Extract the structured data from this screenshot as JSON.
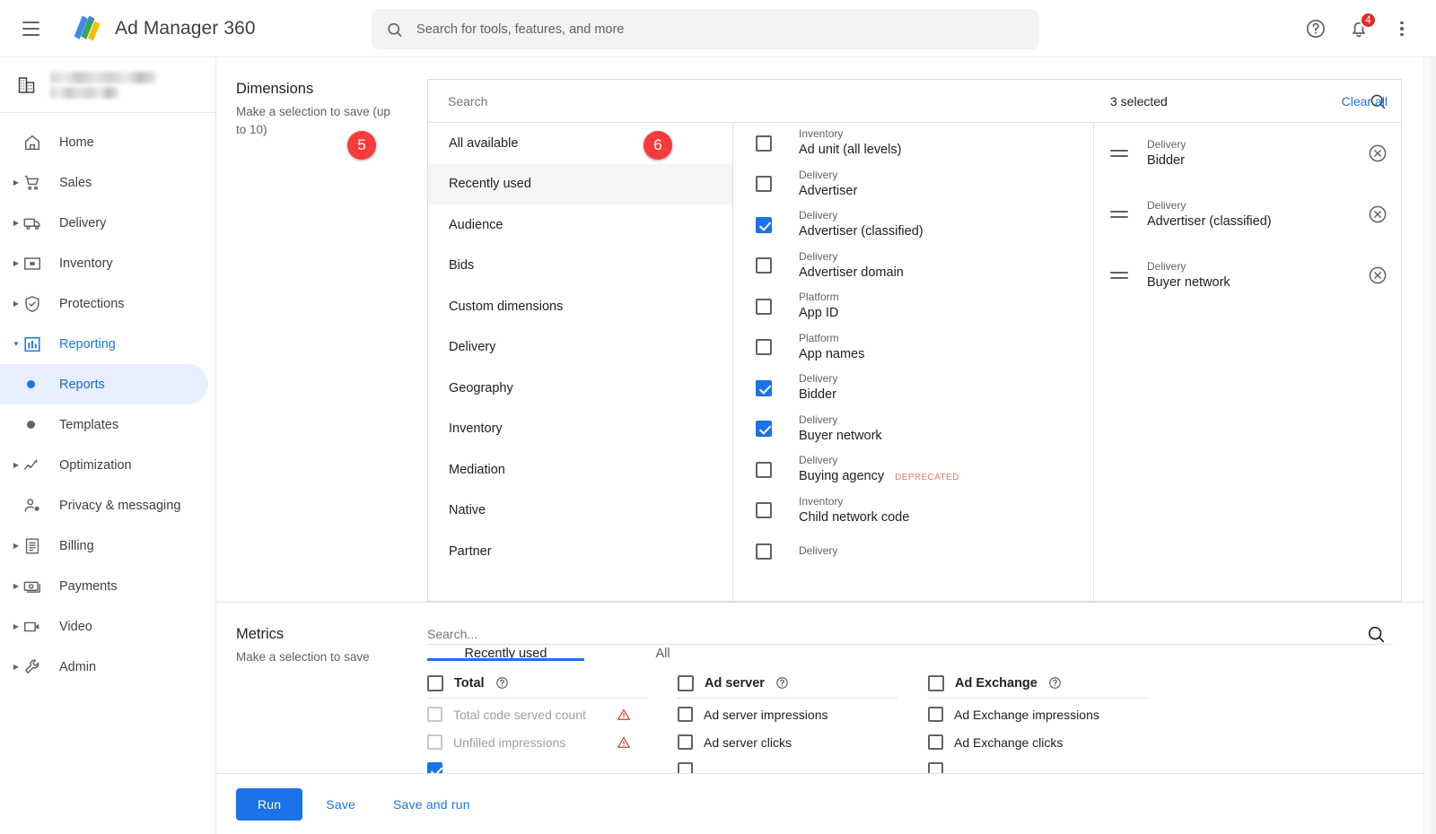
{
  "app": {
    "title": "Ad Manager 360",
    "menu_icon": "hamburger-menu-icon",
    "logo_icon": "ad-manager-logo-icon"
  },
  "search": {
    "placeholder": "Search for tools, features, and more",
    "value": "",
    "icon": "search-icon"
  },
  "topbar_actions": {
    "help": {
      "icon": "help-circle-icon",
      "label": "Help"
    },
    "notifications": {
      "icon": "bell-icon",
      "count": "4"
    },
    "more": {
      "icon": "more-vert-icon",
      "label": "More options"
    }
  },
  "sidebar": {
    "account": {
      "icon": "business-building-icon",
      "name_redacted": true
    },
    "items": [
      {
        "label": "Home",
        "icon": "home-icon",
        "expandable": false
      },
      {
        "label": "Sales",
        "icon": "cart-icon",
        "expandable": true
      },
      {
        "label": "Delivery",
        "icon": "truck-icon",
        "expandable": true
      },
      {
        "label": "Inventory",
        "icon": "inventory-box-icon",
        "expandable": true
      },
      {
        "label": "Protections",
        "icon": "shield-check-icon",
        "expandable": true
      },
      {
        "label": "Reporting",
        "icon": "bar-chart-icon",
        "expandable": true,
        "expanded": true,
        "active": true
      },
      {
        "label": "Optimization",
        "icon": "trending-up-icon",
        "expandable": true
      },
      {
        "label": "Privacy & messaging",
        "icon": "person-settings-icon",
        "expandable": false
      },
      {
        "label": "Billing",
        "icon": "receipt-icon",
        "expandable": true
      },
      {
        "label": "Payments",
        "icon": "money-icon",
        "expandable": true
      },
      {
        "label": "Video",
        "icon": "video-camera-icon",
        "expandable": true
      },
      {
        "label": "Admin",
        "icon": "wrench-icon",
        "expandable": true
      }
    ],
    "sub_items": [
      {
        "label": "Reports",
        "selected": true
      },
      {
        "label": "Templates",
        "selected": false
      }
    ]
  },
  "dimensions": {
    "title": "Dimensions",
    "subtitle": "Make a selection to save (up to 10)",
    "search_placeholder": "Search",
    "search_value": "",
    "search_icon": "search-icon",
    "categories": [
      {
        "label": "All available",
        "highlighted": false
      },
      {
        "label": "Recently used",
        "highlighted": true
      },
      {
        "label": "Audience",
        "highlighted": false
      },
      {
        "label": "Bids",
        "highlighted": false
      },
      {
        "label": "Custom dimensions",
        "highlighted": false
      },
      {
        "label": "Delivery",
        "highlighted": false
      },
      {
        "label": "Geography",
        "highlighted": false
      },
      {
        "label": "Inventory",
        "highlighted": false
      },
      {
        "label": "Mediation",
        "highlighted": false
      },
      {
        "label": "Native",
        "highlighted": false
      },
      {
        "label": "Partner",
        "highlighted": false
      }
    ],
    "options": [
      {
        "category": "Inventory",
        "name": "Ad unit (all levels)",
        "checked": false
      },
      {
        "category": "Delivery",
        "name": "Advertiser",
        "checked": false
      },
      {
        "category": "Delivery",
        "name": "Advertiser (classified)",
        "checked": true
      },
      {
        "category": "Delivery",
        "name": "Advertiser domain",
        "checked": false
      },
      {
        "category": "Platform",
        "name": "App ID",
        "checked": false
      },
      {
        "category": "Platform",
        "name": "App names",
        "checked": false
      },
      {
        "category": "Delivery",
        "name": "Bidder",
        "checked": true
      },
      {
        "category": "Delivery",
        "name": "Buyer network",
        "checked": true
      },
      {
        "category": "Delivery",
        "name": "Buying agency",
        "checked": false,
        "tag": "DEPRECATED"
      },
      {
        "category": "Inventory",
        "name": "Child network code",
        "checked": false
      },
      {
        "category": "Delivery",
        "name": "",
        "checked": false
      }
    ],
    "selected_panel": {
      "count_label": "3 selected",
      "clear_all_label": "Clear all",
      "items": [
        {
          "category": "Delivery",
          "name": "Bidder",
          "drag_icon": "drag-handle-icon",
          "remove_icon": "remove-circle-icon"
        },
        {
          "category": "Delivery",
          "name": "Advertiser (classified)",
          "drag_icon": "drag-handle-icon",
          "remove_icon": "remove-circle-icon"
        },
        {
          "category": "Delivery",
          "name": "Buyer network",
          "drag_icon": "drag-handle-icon",
          "remove_icon": "remove-circle-icon"
        }
      ]
    }
  },
  "annotations": [
    {
      "number": "5",
      "target": "dimension-checkbox-list"
    },
    {
      "number": "6",
      "target": "selected-dimensions-panel"
    }
  ],
  "metrics": {
    "title": "Metrics",
    "subtitle": "Make a selection to save",
    "search_placeholder": "Search...",
    "search_value": "",
    "search_icon": "search-icon",
    "tabs": [
      {
        "label": "Recently used",
        "active": true
      },
      {
        "label": "All",
        "active": false
      }
    ],
    "columns": [
      {
        "header": {
          "label": "Total",
          "checked": false,
          "help_icon": "help-circle-icon"
        },
        "items": [
          {
            "label": "Total code served count",
            "checked": false,
            "disabled": true,
            "warning_icon": "warning-triangle-icon"
          },
          {
            "label": "Unfilled impressions",
            "checked": false,
            "disabled": true,
            "warning_icon": "warning-triangle-icon"
          }
        ]
      },
      {
        "header": {
          "label": "Ad server",
          "checked": false,
          "help_icon": "help-circle-icon"
        },
        "items": [
          {
            "label": "Ad server impressions",
            "checked": false,
            "disabled": false
          },
          {
            "label": "Ad server clicks",
            "checked": false,
            "disabled": false
          }
        ]
      },
      {
        "header": {
          "label": "Ad Exchange",
          "checked": false,
          "help_icon": "help-circle-icon"
        },
        "items": [
          {
            "label": "Ad Exchange impressions",
            "checked": false,
            "disabled": false
          },
          {
            "label": "Ad Exchange clicks",
            "checked": false,
            "disabled": false
          }
        ]
      }
    ]
  },
  "footer": {
    "run_label": "Run",
    "save_label": "Save",
    "save_and_run_label": "Save and run"
  },
  "colors": {
    "accent_blue": "#1a73e8",
    "selected_bg": "#e8f0fe",
    "annotation_red": "#f93b3b",
    "badge_red": "#d93025",
    "deprecated_tag": "#e07a72",
    "warning_red": "#d93025"
  }
}
